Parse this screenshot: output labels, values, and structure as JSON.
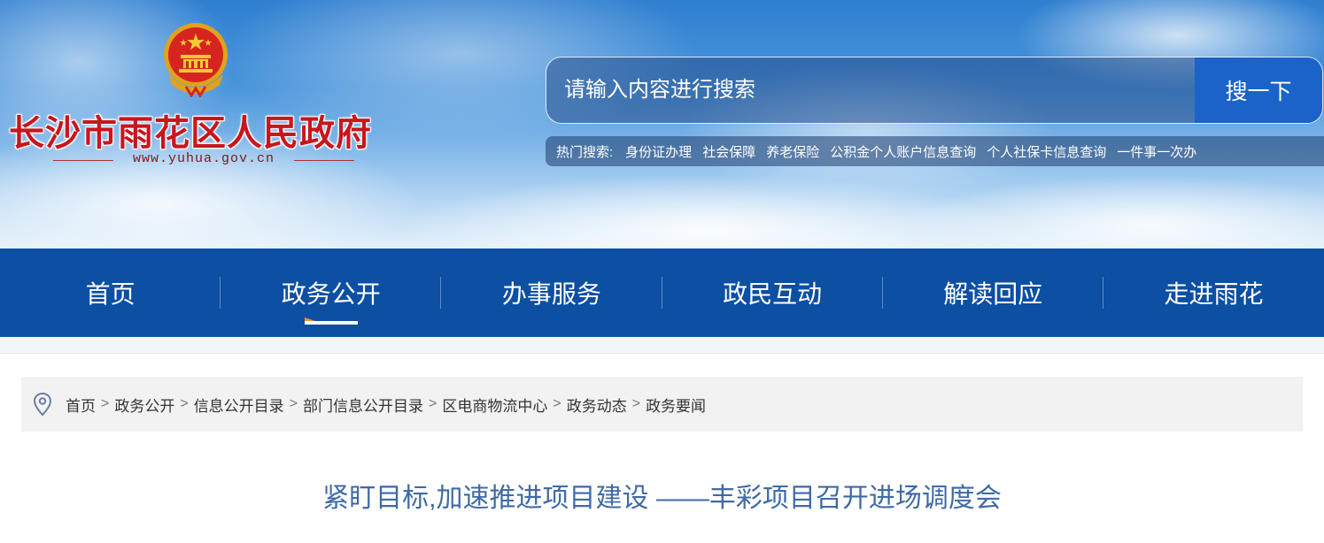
{
  "header": {
    "site_title": "长沙市雨花区人民政府",
    "site_url": "www.yuhua.gov.cn",
    "emblem_icon": "national-emblem-icon"
  },
  "search": {
    "placeholder": "请输入内容进行搜索",
    "button_label": "搜一下",
    "hot_label": "热门搜索:",
    "hot_items": [
      "身份证办理",
      "社会保障",
      "养老保险",
      "公积金个人账户信息查询",
      "个人社保卡信息查询",
      "一件事一次办"
    ]
  },
  "nav": {
    "items": [
      {
        "label": "首页"
      },
      {
        "label": "政务公开"
      },
      {
        "label": "办事服务"
      },
      {
        "label": "政民互动"
      },
      {
        "label": "解读回应"
      },
      {
        "label": "走进雨花"
      }
    ],
    "active_index": 1
  },
  "breadcrumb": {
    "icon": "location-pin-icon",
    "separator": ">",
    "items": [
      "首页",
      "政务公开",
      "信息公开目录",
      "部门信息公开目录",
      "区电商物流中心",
      "政务动态",
      "政务要闻"
    ]
  },
  "article": {
    "title": "紧盯目标,加速推进项目建设 ——丰彩项目召开进场调度会"
  },
  "colors": {
    "nav_bg": "#0c4fa3",
    "search_button": "#1b63c8",
    "title_red": "#c8161d",
    "article_title": "#3f6aa6",
    "active_accent": "#e8923a"
  }
}
